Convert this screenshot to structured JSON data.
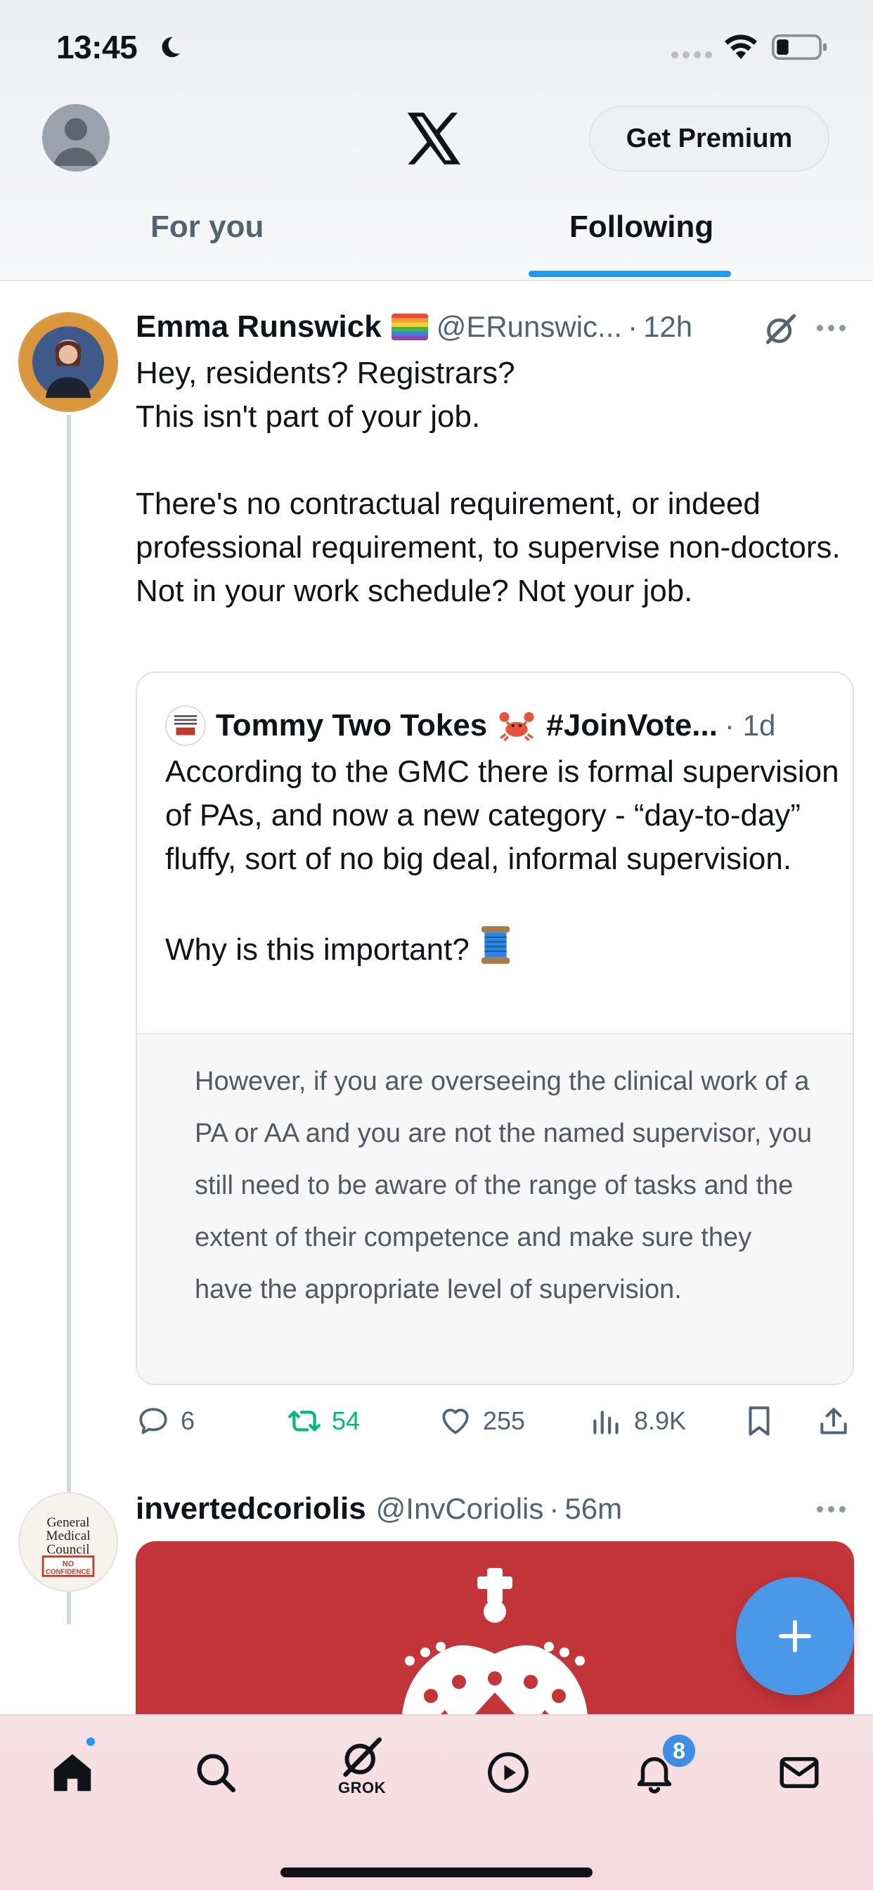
{
  "status_bar": {
    "time": "13:45"
  },
  "header": {
    "premium_label": "Get Premium",
    "tabs": [
      {
        "label": "For you",
        "active": false
      },
      {
        "label": "Following",
        "active": true
      }
    ]
  },
  "post1": {
    "name": "Emma Runswick",
    "handle": "@ERunswic...",
    "dot": "·",
    "time": "12h",
    "text": "Hey, residents? Registrars?\nThis isn't part of your job.\n\nThere's no contractual requirement, or indeed professional requirement, to supervise non-doctors. Not in your work schedule? Not your job.",
    "quote": {
      "name": "Tommy Two Tokes",
      "tag": "#JoinVote...",
      "dot": "·",
      "time": "1d",
      "text": "According to the GMC there is formal supervision of PAs, and now a new category - “day-to-day” fluffy, sort of no big deal, informal supervision.\n\nWhy is this important?",
      "image_text": "However, if you are overseeing the clinical work of a PA or AA and you are not the named supervisor, you still need to be aware of the range of tasks and the extent of their competence and make sure they have the appropriate level of supervision."
    },
    "stats": {
      "replies": "6",
      "reposts": "54",
      "likes": "255",
      "views": "8.9K"
    }
  },
  "post2": {
    "name": "invertedcoriolis",
    "handle": "@InvCoriolis",
    "dot": "·",
    "time": "56m",
    "avatar_lines": [
      "General",
      "Medical",
      "Council",
      "NO",
      "CONFIDENCE"
    ]
  },
  "bottom_nav": {
    "grok_label": "GROK",
    "notification_count": "8"
  },
  "colors": {
    "accent": "#1d9bf0",
    "repost_green": "#00ba7c",
    "fab_blue": "#4a99e9",
    "nav_bg": "#f7d9de"
  }
}
